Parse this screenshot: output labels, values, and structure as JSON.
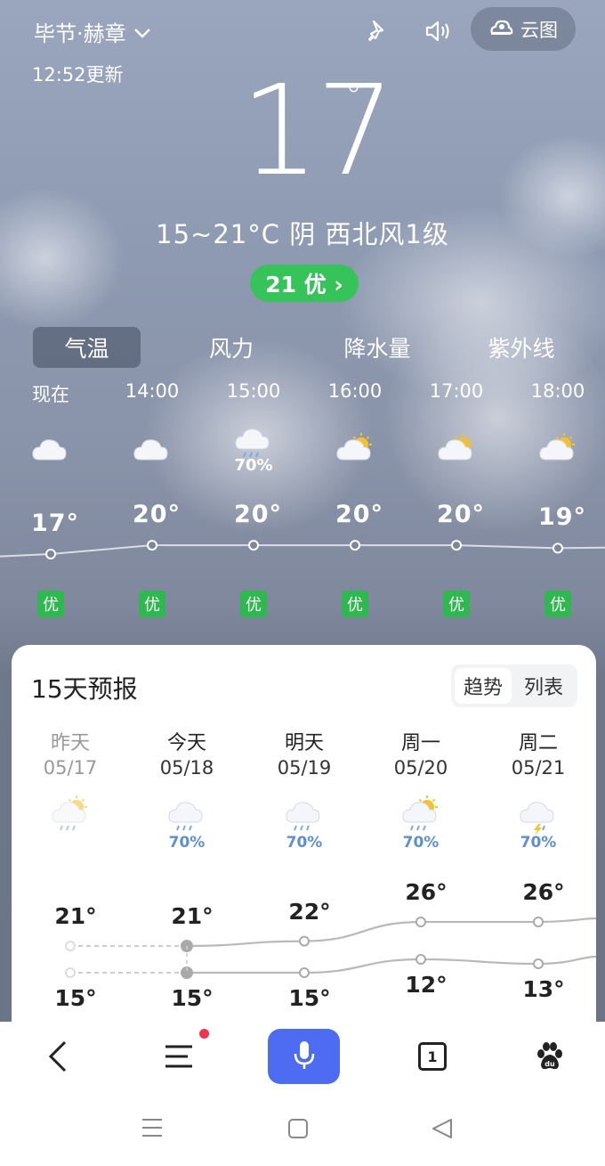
{
  "header": {
    "location": "毕节·赫章",
    "update_time": "12:52更新",
    "cloud_map_label": "云图",
    "icons": [
      "location-pin-icon",
      "speaker-icon",
      "cloud-map-icon"
    ]
  },
  "current": {
    "temperature": "17",
    "degree_symbol": "°",
    "summary": "15~21°C 阴 西北风1级",
    "aqi_label": "21 优 ›",
    "aqi_color": "#35c35a"
  },
  "tabs": [
    "气温",
    "风力",
    "降水量",
    "紫外线"
  ],
  "hourly": [
    {
      "time": "现在",
      "icon": "cloudy",
      "temp": "17°",
      "value": 17,
      "air": "优",
      "pct": ""
    },
    {
      "time": "14:00",
      "icon": "cloudy",
      "temp": "20°",
      "value": 20,
      "air": "优",
      "pct": ""
    },
    {
      "time": "15:00",
      "icon": "rain",
      "temp": "20°",
      "value": 20,
      "air": "优",
      "pct": "70%"
    },
    {
      "time": "16:00",
      "icon": "partly-sunny",
      "temp": "20°",
      "value": 20,
      "air": "优",
      "pct": ""
    },
    {
      "time": "17:00",
      "icon": "partly-sunny",
      "temp": "20°",
      "value": 20,
      "air": "优",
      "pct": ""
    },
    {
      "time": "18:00",
      "icon": "partly-sunny",
      "temp": "19°",
      "value": 19,
      "air": "优",
      "pct": ""
    }
  ],
  "forecast": {
    "title": "15天预报",
    "toggle": [
      "趋势",
      "列表"
    ],
    "days": [
      {
        "name": "昨天",
        "date": "05/17",
        "icon": "sun-rain",
        "pct": "",
        "high": "21°",
        "low": "15°",
        "hv": 21,
        "lv": 15
      },
      {
        "name": "今天",
        "date": "05/18",
        "icon": "rain",
        "pct": "70%",
        "high": "21°",
        "low": "15°",
        "hv": 21,
        "lv": 15
      },
      {
        "name": "明天",
        "date": "05/19",
        "icon": "rain",
        "pct": "70%",
        "high": "22°",
        "low": "15°",
        "hv": 22,
        "lv": 15
      },
      {
        "name": "周一",
        "date": "05/20",
        "icon": "sun-rain",
        "pct": "70%",
        "high": "26°",
        "low": "12°",
        "hv": 26,
        "lv": 12
      },
      {
        "name": "周二",
        "date": "05/21",
        "icon": "thunder-rain",
        "pct": "70%",
        "high": "26°",
        "low": "13°",
        "hv": 26,
        "lv": 13
      }
    ]
  },
  "bottom_nav": {
    "tab_count": "1",
    "icons": [
      "back-icon",
      "menu-icon",
      "mic-icon",
      "tabs-icon",
      "baidu-paw-icon"
    ]
  },
  "system_nav": [
    "recent-apps-icon",
    "home-icon",
    "back-triangle-icon"
  ]
}
